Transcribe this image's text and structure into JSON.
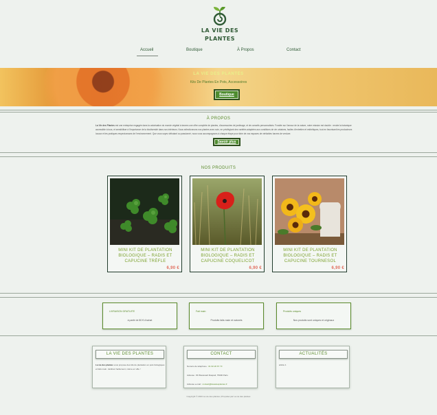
{
  "brand": {
    "title_line1": "LA VIE DES",
    "title_line2": "PLANTES",
    "logo_icon": "sprout-spiral-icon",
    "accent": "#5a8a2a",
    "dark_green": "#2f5a35",
    "price_color": "#e06a5a"
  },
  "nav": [
    {
      "label": "Accueil",
      "active": true
    },
    {
      "label": "Boutique",
      "active": false
    },
    {
      "label": "À Propos",
      "active": false
    },
    {
      "label": "Contact",
      "active": false
    }
  ],
  "hero": {
    "title": "LA VIE DES PLANTES",
    "subtitle": "Kits De Plantes En Pots, Accessoires",
    "button": "Boutique"
  },
  "about": {
    "title": "À PROPOS",
    "brand_name": "La Vie des Plantes",
    "text": "est une entreprise engagée dans la valorisation du monde végétal à travers une offre complète de plantes, d'accessoires de jardinage, et de conseils personnalisés. Fondée sur l'amour de la nature, notre mission est double : rendre la botanique accessible à tous, et sensibiliser à l'importance de la biodiversité dans nos intérieurs. Nous sélectionnons nos plantes avec soin, en privilégiant des variétés adaptées aux conditions de vie urbaines, faciles d'entretien et esthétiques, tout en favorisant les producteurs locaux et les pratiques respectueuses de l'environnement. Que vous soyez débutant ou passionné, nous vous accompagnons à chaque étape pour faire de vos espaces de véritables havres de verdure.",
    "button": "Savoir plus"
  },
  "products": {
    "title": "NOS PRODUITS",
    "items": [
      {
        "name": "MINI KIT DE PLANTATION BIOLOGIQUE – RADIS ET CAPUCINE TRÈFLE",
        "price": "6,90 €",
        "image": "clover-photo"
      },
      {
        "name": "MINI KIT DE PLANTATION BIOLOGIQUE – RADIS ET CAPUCINE COQUELICOT",
        "price": "6,90 €",
        "image": "poppy-photo"
      },
      {
        "name": "MINI KIT DE PLANTATION BIOLOGIQUE – RADIS ET CAPUCINE TOURNESOL",
        "price": "6,90 €",
        "image": "sunflower-photo"
      }
    ]
  },
  "features": [
    {
      "title": "LIVRAISON GRATUITE",
      "text": "à partir de 80 € d'achat"
    },
    {
      "title": "Fait main",
      "text": "Produits faits main et naturels"
    },
    {
      "title": "Produits uniques",
      "text": "Nos produits sont uniques et originaux"
    }
  ],
  "footer": {
    "about": {
      "title": "LA VIE DES PLANTES",
      "brand": "La vie des plantes",
      "text": "vous propose des kits de plantation en pots biologiques et faits main. Jardinez facilement, même en ville !"
    },
    "contact": {
      "title": "CONTACT",
      "phone_label": "Numéro de téléphone :",
      "phone": "01 90 26 67 73",
      "address_label": "Adresse :",
      "address": "80 Boulevard Raspail, 75006 Paris",
      "email_label": "Adresse e-mail :",
      "email": "contact@laviedesplantes.fr"
    },
    "news": {
      "title": "ACTUALITÉS",
      "text": "article 1"
    },
    "copyright": "Copyright © 2023 La vie des plantes | Propulsé par La vie des plantes"
  }
}
